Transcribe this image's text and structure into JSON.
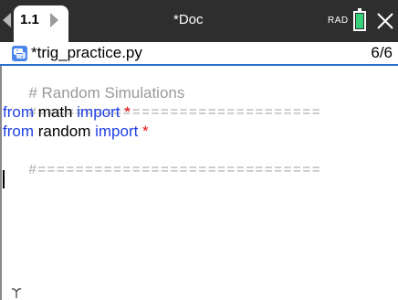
{
  "topbar": {
    "tab_label": "1.1",
    "doc_title": "*Doc",
    "mode": "RAD"
  },
  "file": {
    "name": "*trig_practice.py",
    "position": "6/6"
  },
  "editor": {
    "lines": [
      {
        "text": "# Random Simulations"
      },
      {
        "text": "#=============================="
      },
      {
        "keyword1": "from",
        "module": " math ",
        "keyword2": "import",
        "star": " *"
      },
      {
        "keyword1": "from",
        "module": " random ",
        "keyword2": "import",
        "star": " *"
      },
      {
        "text": "#=============================="
      }
    ]
  },
  "colors": {
    "topbar_bg": "#2e2e2e",
    "keyword": "#1f3fe6",
    "comment": "#9a9a9a",
    "star": "#ee1111",
    "battery": "#34d07a",
    "underline": "#2e6fd4"
  },
  "icons": {
    "nav_left": "triangle-left-icon",
    "nav_right": "triangle-right-icon",
    "battery": "battery-icon",
    "close": "close-icon",
    "python": "python-icon",
    "cursor": "text-cursor"
  }
}
